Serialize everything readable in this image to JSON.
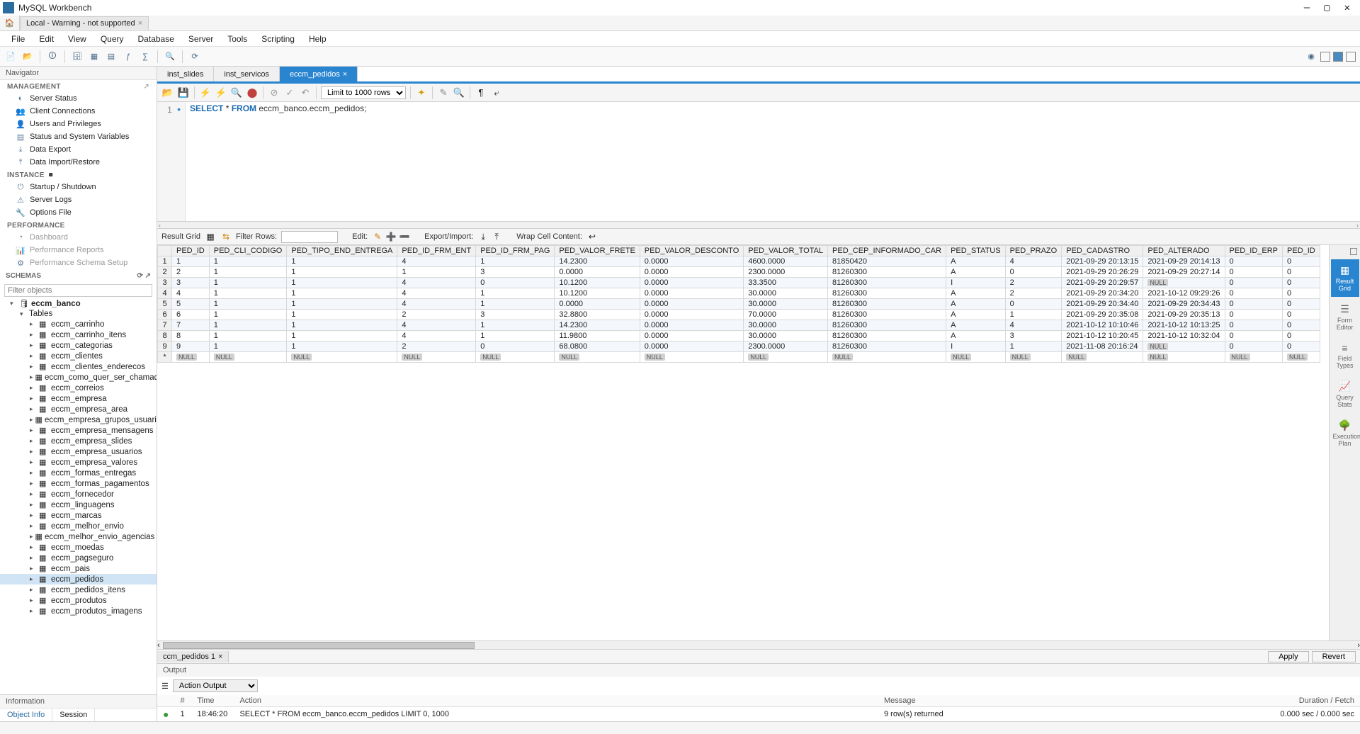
{
  "app": {
    "title": "MySQL Workbench"
  },
  "connectionTab": {
    "label": "Local - Warning - not supported"
  },
  "menu": [
    "File",
    "Edit",
    "View",
    "Query",
    "Database",
    "Server",
    "Tools",
    "Scripting",
    "Help"
  ],
  "navigator": {
    "title": "Navigator",
    "management": {
      "header": "MANAGEMENT",
      "items": [
        "Server Status",
        "Client Connections",
        "Users and Privileges",
        "Status and System Variables",
        "Data Export",
        "Data Import/Restore"
      ]
    },
    "instance": {
      "header": "INSTANCE",
      "items": [
        "Startup / Shutdown",
        "Server Logs",
        "Options File"
      ]
    },
    "performance": {
      "header": "PERFORMANCE",
      "items": [
        "Dashboard",
        "Performance Reports",
        "Performance Schema Setup"
      ]
    },
    "schemas": {
      "header": "SCHEMAS",
      "filterPlaceholder": "Filter objects",
      "database": "eccm_banco",
      "tablesLabel": "Tables",
      "tables": [
        "eccm_carrinho",
        "eccm_carrinho_itens",
        "eccm_categorias",
        "eccm_clientes",
        "eccm_clientes_enderecos",
        "eccm_como_quer_ser_chamado",
        "eccm_correios",
        "eccm_empresa",
        "eccm_empresa_area",
        "eccm_empresa_grupos_usuarios",
        "eccm_empresa_mensagens",
        "eccm_empresa_slides",
        "eccm_empresa_usuarios",
        "eccm_empresa_valores",
        "eccm_formas_entregas",
        "eccm_formas_pagamentos",
        "eccm_fornecedor",
        "eccm_linguagens",
        "eccm_marcas",
        "eccm_melhor_envio",
        "eccm_melhor_envio_agencias",
        "eccm_moedas",
        "eccm_pagseguro",
        "eccm_pais",
        "eccm_pedidos",
        "eccm_pedidos_itens",
        "eccm_produtos",
        "eccm_produtos_imagens"
      ],
      "selected": "eccm_pedidos"
    },
    "info": {
      "header": "Information",
      "tabs": [
        "Object Info",
        "Session"
      ],
      "activeTab": 0
    }
  },
  "queryTabs": {
    "tabs": [
      "inst_slides",
      "inst_servicos",
      "eccm_pedidos"
    ],
    "active": 2
  },
  "queryToolbar": {
    "limitLabel": "Limit to 1000 rows"
  },
  "editor": {
    "lineNum": "1",
    "sql": {
      "kw1": "SELECT",
      "star": "*",
      "kw2": "FROM",
      "obj": "eccm_banco.eccm_pedidos;"
    }
  },
  "resultToolbar": {
    "resultGrid": "Result Grid",
    "filterRows": "Filter Rows:",
    "edit": "Edit:",
    "exportImport": "Export/Import:",
    "wrapCell": "Wrap Cell Content:"
  },
  "resultGrid": {
    "columns": [
      "PED_ID",
      "PED_CLI_CODIGO",
      "PED_TIPO_END_ENTREGA",
      "PED_ID_FRM_ENT",
      "PED_ID_FRM_PAG",
      "PED_VALOR_FRETE",
      "PED_VALOR_DESCONTO",
      "PED_VALOR_TOTAL",
      "PED_CEP_INFORMADO_CAR",
      "PED_STATUS",
      "PED_PRAZO",
      "PED_CADASTRO",
      "PED_ALTERADO",
      "PED_ID_ERP",
      "PED_ID"
    ],
    "rows": [
      [
        "1",
        "1",
        "1",
        "4",
        "1",
        "14.2300",
        "0.0000",
        "4600.0000",
        "81850420",
        "A",
        "4",
        "2021-09-29 20:13:15",
        "2021-09-29 20:14:13",
        "0",
        "0"
      ],
      [
        "2",
        "1",
        "1",
        "1",
        "3",
        "0.0000",
        "0.0000",
        "2300.0000",
        "81260300",
        "A",
        "0",
        "2021-09-29 20:26:29",
        "2021-09-29 20:27:14",
        "0",
        "0"
      ],
      [
        "3",
        "1",
        "1",
        "4",
        "0",
        "10.1200",
        "0.0000",
        "33.3500",
        "81260300",
        "I",
        "2",
        "2021-09-29 20:29:57",
        "NULL",
        "0",
        "0"
      ],
      [
        "4",
        "1",
        "1",
        "4",
        "1",
        "10.1200",
        "0.0000",
        "30.0000",
        "81260300",
        "A",
        "2",
        "2021-09-29 20:34:20",
        "2021-10-12 09:29:26",
        "0",
        "0"
      ],
      [
        "5",
        "1",
        "1",
        "4",
        "1",
        "0.0000",
        "0.0000",
        "30.0000",
        "81260300",
        "A",
        "0",
        "2021-09-29 20:34:40",
        "2021-09-29 20:34:43",
        "0",
        "0"
      ],
      [
        "6",
        "1",
        "1",
        "2",
        "3",
        "32.8800",
        "0.0000",
        "70.0000",
        "81260300",
        "A",
        "1",
        "2021-09-29 20:35:08",
        "2021-09-29 20:35:13",
        "0",
        "0"
      ],
      [
        "7",
        "1",
        "1",
        "4",
        "1",
        "14.2300",
        "0.0000",
        "30.0000",
        "81260300",
        "A",
        "4",
        "2021-10-12 10:10:46",
        "2021-10-12 10:13:25",
        "0",
        "0"
      ],
      [
        "8",
        "1",
        "1",
        "4",
        "1",
        "11.9800",
        "0.0000",
        "30.0000",
        "81260300",
        "A",
        "3",
        "2021-10-12 10:20:45",
        "2021-10-12 10:32:04",
        "0",
        "0"
      ],
      [
        "9",
        "1",
        "1",
        "2",
        "0",
        "68.0800",
        "0.0000",
        "2300.0000",
        "81260300",
        "I",
        "1",
        "2021-11-08 20:16:24",
        "NULL",
        "0",
        "0"
      ]
    ]
  },
  "sidePanels": [
    "Result Grid",
    "Form Editor",
    "Field Types",
    "Query Stats",
    "Execution Plan"
  ],
  "resultBottom": {
    "tabLabel": "ccm_pedidos 1",
    "apply": "Apply",
    "revert": "Revert"
  },
  "output": {
    "header": "Output",
    "typeLabel": "Action Output",
    "columns": {
      "num": "#",
      "time": "Time",
      "action": "Action",
      "message": "Message",
      "duration": "Duration / Fetch"
    },
    "row": {
      "num": "1",
      "time": "18:46:20",
      "action": "SELECT * FROM eccm_banco.eccm_pedidos LIMIT 0, 1000",
      "message": "9 row(s) returned",
      "duration": "0.000 sec / 0.000 sec"
    }
  }
}
